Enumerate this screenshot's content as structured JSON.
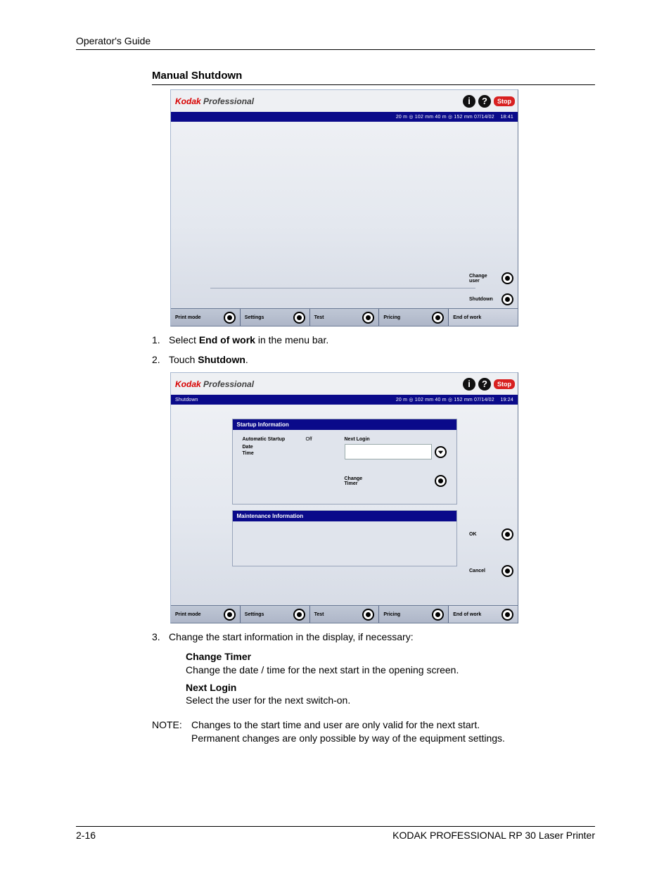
{
  "doc": {
    "header": "Operator's Guide",
    "section_title": "Manual Shutdown",
    "footer_page": "2-16",
    "footer_product": "KODAK PROFESSIONAL RP 30 Laser Printer"
  },
  "steps": {
    "s1": {
      "n": "1.",
      "pre": "Select ",
      "bold": "End of work",
      "post": " in the menu bar."
    },
    "s2": {
      "n": "2.",
      "pre": "Touch ",
      "bold": "Shutdown",
      "post": "."
    },
    "s3": {
      "n": "3.",
      "txt": "Change the start information in the display, if necessary:"
    },
    "ct_h": "Change Timer",
    "ct_t": "Change the date / time for the next start in the opening screen.",
    "nl_h": "Next Login",
    "nl_t": "Select the user for the next switch-on."
  },
  "note": {
    "label": "NOTE:",
    "line1": "Changes to the start time and user are only valid for the next start.",
    "line2": "Permanent changes are only possible by way of the equipment settings."
  },
  "ui": {
    "brand_k": "Kodak",
    "brand_p": " Professional",
    "stop": "Stop",
    "info_glyph": "i",
    "help_glyph": "?",
    "status_a": "20 m ◎ 102 mm   40 m ◎ 152 mm  07/14/02",
    "time_a": "18:41",
    "status_b": "20 m ◎ 102 mm   40 m ◎ 152 mm  07/14/02",
    "time_b": "19:24",
    "shutdown_crumb": "Shutdown",
    "change_user": "Change user",
    "shutdown": "Shutdown",
    "ok": "OK",
    "cancel": "Cancel",
    "menu": {
      "print_mode": "Print mode",
      "settings": "Settings",
      "test": "Test",
      "pricing": "Pricing",
      "end_of_work": "End of work"
    },
    "panel1_title": "Startup Information",
    "auto_startup": "Automatic Startup",
    "off": "Off",
    "date": "Date",
    "time_lbl": "Time",
    "next_login": "Next Login",
    "change_timer": "Change Timer",
    "panel2_title": "Maintenance Information"
  }
}
